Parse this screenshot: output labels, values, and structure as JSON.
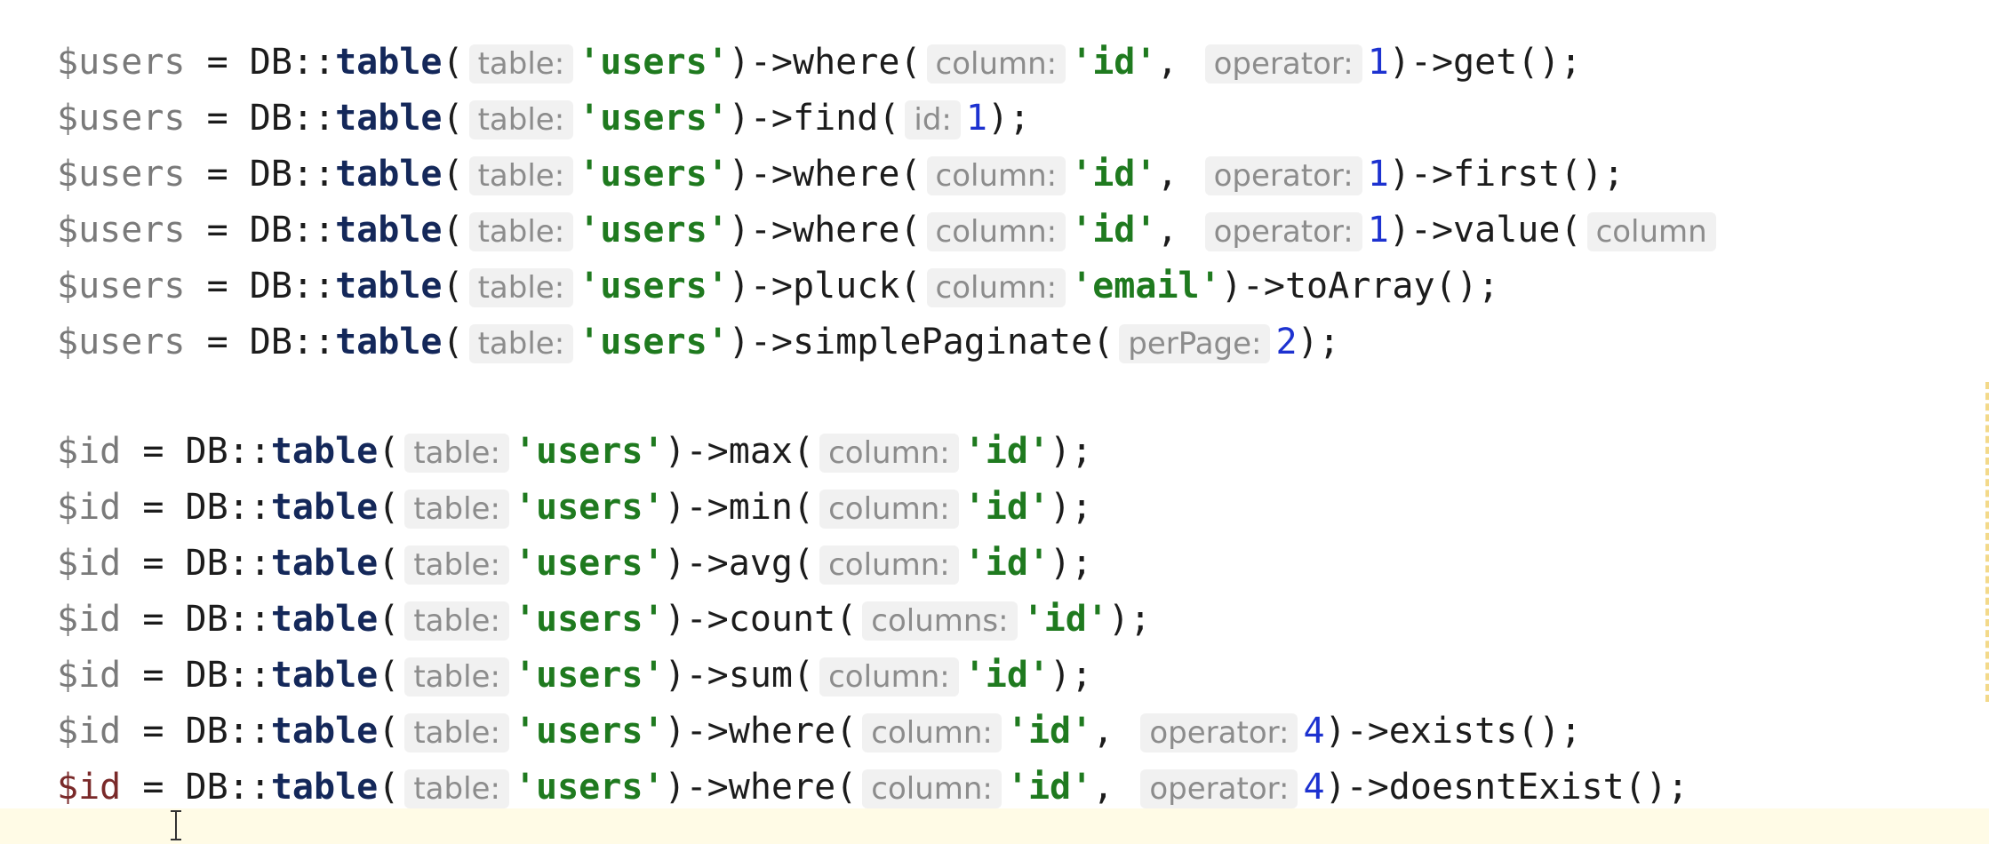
{
  "editor": {
    "lines": [
      {
        "tokens": [
          {
            "c": "var",
            "t": "$users"
          },
          {
            "c": "op",
            "t": " = "
          },
          {
            "c": "plain",
            "t": "DB::"
          },
          {
            "c": "method",
            "t": "table"
          },
          {
            "c": "plain",
            "t": "("
          },
          {
            "c": "hint",
            "t": "table:"
          },
          {
            "c": "str",
            "t": "'users'"
          },
          {
            "c": "plain",
            "t": ")->where("
          },
          {
            "c": "hint",
            "t": "column:"
          },
          {
            "c": "str",
            "t": "'id'"
          },
          {
            "c": "plain",
            "t": ", "
          },
          {
            "c": "hint",
            "t": "operator:"
          },
          {
            "c": "num",
            "t": "1"
          },
          {
            "c": "plain",
            "t": ")->get();"
          }
        ]
      },
      {
        "tokens": [
          {
            "c": "var",
            "t": "$users"
          },
          {
            "c": "op",
            "t": " = "
          },
          {
            "c": "plain",
            "t": "DB::"
          },
          {
            "c": "method",
            "t": "table"
          },
          {
            "c": "plain",
            "t": "("
          },
          {
            "c": "hint",
            "t": "table:"
          },
          {
            "c": "str",
            "t": "'users'"
          },
          {
            "c": "plain",
            "t": ")->find("
          },
          {
            "c": "hint",
            "t": "id:"
          },
          {
            "c": "num",
            "t": "1"
          },
          {
            "c": "plain",
            "t": ");"
          }
        ]
      },
      {
        "tokens": [
          {
            "c": "var",
            "t": "$users"
          },
          {
            "c": "op",
            "t": " = "
          },
          {
            "c": "plain",
            "t": "DB::"
          },
          {
            "c": "method",
            "t": "table"
          },
          {
            "c": "plain",
            "t": "("
          },
          {
            "c": "hint",
            "t": "table:"
          },
          {
            "c": "str",
            "t": "'users'"
          },
          {
            "c": "plain",
            "t": ")->where("
          },
          {
            "c": "hint",
            "t": "column:"
          },
          {
            "c": "str",
            "t": "'id'"
          },
          {
            "c": "plain",
            "t": ", "
          },
          {
            "c": "hint",
            "t": "operator:"
          },
          {
            "c": "num",
            "t": "1"
          },
          {
            "c": "plain",
            "t": ")->first();"
          }
        ]
      },
      {
        "tokens": [
          {
            "c": "var",
            "t": "$users"
          },
          {
            "c": "op",
            "t": " = "
          },
          {
            "c": "plain",
            "t": "DB::"
          },
          {
            "c": "method",
            "t": "table"
          },
          {
            "c": "plain",
            "t": "("
          },
          {
            "c": "hint",
            "t": "table:"
          },
          {
            "c": "str",
            "t": "'users'"
          },
          {
            "c": "plain",
            "t": ")->where("
          },
          {
            "c": "hint",
            "t": "column:"
          },
          {
            "c": "str",
            "t": "'id'"
          },
          {
            "c": "plain",
            "t": ", "
          },
          {
            "c": "hint",
            "t": "operator:"
          },
          {
            "c": "num",
            "t": "1"
          },
          {
            "c": "plain",
            "t": ")->value("
          },
          {
            "c": "hint",
            "t": "column"
          }
        ]
      },
      {
        "tokens": [
          {
            "c": "var",
            "t": "$users"
          },
          {
            "c": "op",
            "t": " = "
          },
          {
            "c": "plain",
            "t": "DB::"
          },
          {
            "c": "method",
            "t": "table"
          },
          {
            "c": "plain",
            "t": "("
          },
          {
            "c": "hint",
            "t": "table:"
          },
          {
            "c": "str",
            "t": "'users'"
          },
          {
            "c": "plain",
            "t": ")->pluck("
          },
          {
            "c": "hint",
            "t": "column:"
          },
          {
            "c": "str",
            "t": "'email'"
          },
          {
            "c": "plain",
            "t": ")->toArray();"
          }
        ]
      },
      {
        "tokens": [
          {
            "c": "var",
            "t": "$users"
          },
          {
            "c": "op",
            "t": " = "
          },
          {
            "c": "plain",
            "t": "DB::"
          },
          {
            "c": "method",
            "t": "table"
          },
          {
            "c": "plain",
            "t": "("
          },
          {
            "c": "hint",
            "t": "table:"
          },
          {
            "c": "str",
            "t": "'users'"
          },
          {
            "c": "plain",
            "t": ")->simplePaginate("
          },
          {
            "c": "hint",
            "t": "perPage:"
          },
          {
            "c": "num",
            "t": "2"
          },
          {
            "c": "plain",
            "t": ");"
          }
        ]
      },
      {
        "tokens": [
          {
            "c": "var",
            "t": "$id"
          },
          {
            "c": "op",
            "t": " = "
          },
          {
            "c": "plain",
            "t": "DB::"
          },
          {
            "c": "method",
            "t": "table"
          },
          {
            "c": "plain",
            "t": "("
          },
          {
            "c": "hint",
            "t": "table:"
          },
          {
            "c": "str",
            "t": "'users'"
          },
          {
            "c": "plain",
            "t": ")->max("
          },
          {
            "c": "hint",
            "t": "column:"
          },
          {
            "c": "str",
            "t": "'id'"
          },
          {
            "c": "plain",
            "t": ");"
          }
        ]
      },
      {
        "tokens": [
          {
            "c": "var",
            "t": "$id"
          },
          {
            "c": "op",
            "t": " = "
          },
          {
            "c": "plain",
            "t": "DB::"
          },
          {
            "c": "method",
            "t": "table"
          },
          {
            "c": "plain",
            "t": "("
          },
          {
            "c": "hint",
            "t": "table:"
          },
          {
            "c": "str",
            "t": "'users'"
          },
          {
            "c": "plain",
            "t": ")->min("
          },
          {
            "c": "hint",
            "t": "column:"
          },
          {
            "c": "str",
            "t": "'id'"
          },
          {
            "c": "plain",
            "t": ");"
          }
        ]
      },
      {
        "tokens": [
          {
            "c": "var",
            "t": "$id"
          },
          {
            "c": "op",
            "t": " = "
          },
          {
            "c": "plain",
            "t": "DB::"
          },
          {
            "c": "method",
            "t": "table"
          },
          {
            "c": "plain",
            "t": "("
          },
          {
            "c": "hint",
            "t": "table:"
          },
          {
            "c": "str",
            "t": "'users'"
          },
          {
            "c": "plain",
            "t": ")->avg("
          },
          {
            "c": "hint",
            "t": "column:"
          },
          {
            "c": "str",
            "t": "'id'"
          },
          {
            "c": "plain",
            "t": ");"
          }
        ]
      },
      {
        "tokens": [
          {
            "c": "var",
            "t": "$id"
          },
          {
            "c": "op",
            "t": " = "
          },
          {
            "c": "plain",
            "t": "DB::"
          },
          {
            "c": "method",
            "t": "table"
          },
          {
            "c": "plain",
            "t": "("
          },
          {
            "c": "hint",
            "t": "table:"
          },
          {
            "c": "str",
            "t": "'users'"
          },
          {
            "c": "plain",
            "t": ")->count("
          },
          {
            "c": "hint",
            "t": "columns:"
          },
          {
            "c": "str",
            "t": "'id'"
          },
          {
            "c": "plain",
            "t": ");"
          }
        ]
      },
      {
        "tokens": [
          {
            "c": "var",
            "t": "$id"
          },
          {
            "c": "op",
            "t": " = "
          },
          {
            "c": "plain",
            "t": "DB::"
          },
          {
            "c": "method",
            "t": "table"
          },
          {
            "c": "plain",
            "t": "("
          },
          {
            "c": "hint",
            "t": "table:"
          },
          {
            "c": "str",
            "t": "'users'"
          },
          {
            "c": "plain",
            "t": ")->sum("
          },
          {
            "c": "hint",
            "t": "column:"
          },
          {
            "c": "str",
            "t": "'id'"
          },
          {
            "c": "plain",
            "t": ");"
          }
        ]
      },
      {
        "tokens": [
          {
            "c": "var",
            "t": "$id"
          },
          {
            "c": "op",
            "t": " = "
          },
          {
            "c": "plain",
            "t": "DB::"
          },
          {
            "c": "method",
            "t": "table"
          },
          {
            "c": "plain",
            "t": "("
          },
          {
            "c": "hint",
            "t": "table:"
          },
          {
            "c": "str",
            "t": "'users'"
          },
          {
            "c": "plain",
            "t": ")->where("
          },
          {
            "c": "hint",
            "t": "column:"
          },
          {
            "c": "str",
            "t": "'id'"
          },
          {
            "c": "plain",
            "t": ", "
          },
          {
            "c": "hint",
            "t": "operator:"
          },
          {
            "c": "num",
            "t": "4"
          },
          {
            "c": "plain",
            "t": ")->exists();"
          }
        ]
      },
      {
        "tokens": [
          {
            "c": "var active",
            "t": "$id"
          },
          {
            "c": "op",
            "t": " = "
          },
          {
            "c": "plain",
            "t": "DB::"
          },
          {
            "c": "method",
            "t": "table"
          },
          {
            "c": "plain",
            "t": "("
          },
          {
            "c": "hint",
            "t": "table:"
          },
          {
            "c": "str",
            "t": "'users'"
          },
          {
            "c": "plain",
            "t": ")->where("
          },
          {
            "c": "hint",
            "t": "column:"
          },
          {
            "c": "str",
            "t": "'id'"
          },
          {
            "c": "plain",
            "t": ", "
          },
          {
            "c": "hint",
            "t": "operator:"
          },
          {
            "c": "num",
            "t": "4"
          },
          {
            "c": "plain",
            "t": ")->doesntExist();"
          }
        ]
      }
    ]
  }
}
